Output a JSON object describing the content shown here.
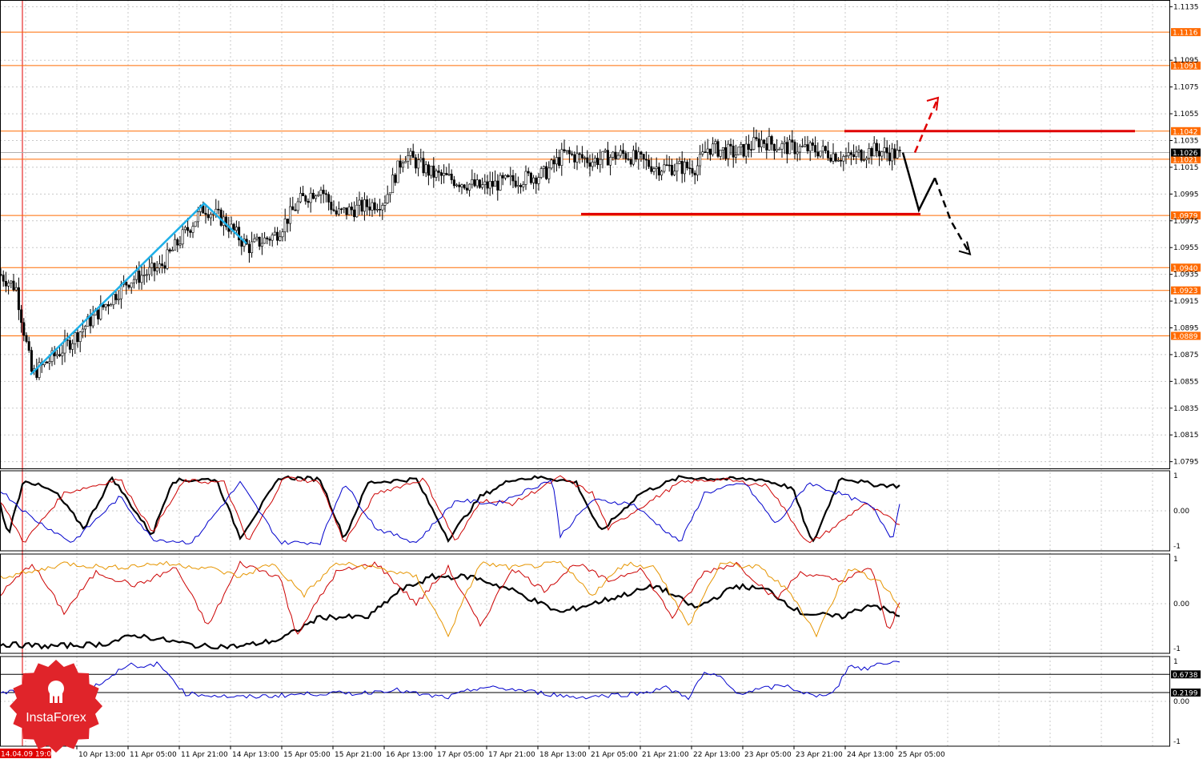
{
  "chart_data": [
    {
      "type": "candlestick",
      "title": "",
      "price_ticks": [
        "1.1135",
        "1.1095",
        "1.1075",
        "1.1055",
        "1.1035",
        "1.1015",
        "1.0995",
        "1.0975",
        "1.0955",
        "1.0935",
        "1.0915",
        "1.0895",
        "1.0875",
        "1.0855",
        "1.0835",
        "1.0815",
        "1.0795"
      ],
      "ylim": [
        1.079,
        1.114
      ],
      "x_tick_labels": [
        "14.04.09 19:00",
        "10 Apr 13:00",
        "11 Apr 05:00",
        "11 Apr 21:00",
        "14 Apr 13:00",
        "15 Apr 05:00",
        "15 Apr 21:00",
        "16 Apr 13:00",
        "17 Apr 05:00",
        "17 Apr 21:00",
        "18 Apr 13:00",
        "21 Apr 05:00",
        "21 Apr 21:00",
        "22 Apr 13:00",
        "23 Apr 05:00",
        "23 Apr 21:00",
        "24 Apr 13:00",
        "25 Apr 05:00"
      ],
      "levels": [
        {
          "label": "1.1116",
          "value": 1.1116
        },
        {
          "label": "1.1091",
          "value": 1.1091
        },
        {
          "label": "1.1042",
          "value": 1.1042
        },
        {
          "label": "1.1021",
          "value": 1.1021
        },
        {
          "label": "1.0979",
          "value": 1.0979
        },
        {
          "label": "1.0940",
          "value": 1.094
        },
        {
          "label": "1.0923",
          "value": 1.0923
        },
        {
          "label": "1.0889",
          "value": 1.0889
        }
      ],
      "current_price": {
        "label": "1.1026",
        "value": 1.1026
      },
      "close_anchors": [
        [
          0,
          1.0935
        ],
        [
          20,
          1.0925
        ],
        [
          40,
          1.086
        ],
        [
          80,
          1.088
        ],
        [
          120,
          1.0905
        ],
        [
          160,
          1.093
        ],
        [
          200,
          1.094
        ],
        [
          230,
          1.0965
        ],
        [
          255,
          1.0985
        ],
        [
          280,
          1.0975
        ],
        [
          310,
          1.0955
        ],
        [
          345,
          1.0965
        ],
        [
          375,
          1.099
        ],
        [
          400,
          1.1
        ],
        [
          420,
          1.098
        ],
        [
          450,
          1.0985
        ],
        [
          480,
          1.099
        ],
        [
          505,
          1.1025
        ],
        [
          540,
          1.101
        ],
        [
          570,
          1.1005
        ],
        [
          600,
          1.1
        ],
        [
          640,
          1.1005
        ],
        [
          680,
          1.101
        ],
        [
          705,
          1.1025
        ],
        [
          740,
          1.102
        ],
        [
          780,
          1.1025
        ],
        [
          820,
          1.1015
        ],
        [
          870,
          1.1015
        ],
        [
          885,
          1.103
        ],
        [
          920,
          1.1025
        ],
        [
          950,
          1.1035
        ],
        [
          980,
          1.103
        ],
        [
          1020,
          1.1028
        ],
        [
          1060,
          1.1022
        ],
        [
          1090,
          1.1028
        ],
        [
          1125,
          1.1024
        ]
      ],
      "support_line": 1.098,
      "resistance_line": 1.1042,
      "forecast_down": [
        [
          1128,
          1.1026
        ],
        [
          1148,
          1.0983
        ],
        [
          1168,
          1.1007
        ],
        [
          1188,
          1.0975
        ],
        [
          1212,
          1.095
        ]
      ],
      "forecast_up": [
        [
          1143,
          1.1026
        ],
        [
          1172,
          1.1067
        ]
      ]
    },
    {
      "type": "line",
      "panel": "oscillator-1",
      "y_ticks": [
        "1",
        "0.00",
        "-1"
      ],
      "ylim": [
        -1,
        1
      ],
      "series": [
        {
          "color": "#000000",
          "anchors": [
            [
              0,
              0.2
            ],
            [
              10,
              -0.7
            ],
            [
              30,
              0.9
            ],
            [
              70,
              0.5
            ],
            [
              105,
              -0.5
            ],
            [
              140,
              0.95
            ],
            [
              190,
              -0.7
            ],
            [
              215,
              0.85
            ],
            [
              270,
              0.9
            ],
            [
              300,
              -0.75
            ],
            [
              350,
              0.95
            ],
            [
              400,
              0.9
            ],
            [
              430,
              -0.8
            ],
            [
              460,
              0.8
            ],
            [
              520,
              0.9
            ],
            [
              560,
              -0.8
            ],
            [
              600,
              0.4
            ],
            [
              640,
              0.9
            ],
            [
              680,
              0.95
            ],
            [
              720,
              0.8
            ],
            [
              750,
              -0.6
            ],
            [
              800,
              0.5
            ],
            [
              850,
              0.95
            ],
            [
              910,
              0.9
            ],
            [
              950,
              0.9
            ],
            [
              990,
              0.65
            ],
            [
              1015,
              -0.95
            ],
            [
              1050,
              0.95
            ],
            [
              1090,
              0.75
            ],
            [
              1125,
              0.7
            ]
          ]
        },
        {
          "color": "#cc0000",
          "anchors": [
            [
              0,
              0.3
            ],
            [
              30,
              -0.9
            ],
            [
              80,
              0.5
            ],
            [
              150,
              0.9
            ],
            [
              190,
              -0.6
            ],
            [
              230,
              0.85
            ],
            [
              280,
              0.8
            ],
            [
              310,
              -0.9
            ],
            [
              355,
              0.95
            ],
            [
              400,
              0.8
            ],
            [
              430,
              -0.9
            ],
            [
              470,
              0.5
            ],
            [
              530,
              0.9
            ],
            [
              570,
              -0.9
            ],
            [
              600,
              0.3
            ],
            [
              640,
              0.2
            ],
            [
              700,
              0.95
            ],
            [
              740,
              0.5
            ],
            [
              760,
              -0.5
            ],
            [
              800,
              0.1
            ],
            [
              850,
              0.8
            ],
            [
              900,
              0.9
            ],
            [
              960,
              0.7
            ],
            [
              1010,
              -0.95
            ],
            [
              1040,
              -0.5
            ],
            [
              1080,
              0.2
            ],
            [
              1125,
              -0.4
            ]
          ]
        },
        {
          "color": "#0000cc",
          "anchors": [
            [
              0,
              0.6
            ],
            [
              40,
              -0.2
            ],
            [
              90,
              -0.9
            ],
            [
              150,
              0.4
            ],
            [
              190,
              -0.8
            ],
            [
              240,
              -0.9
            ],
            [
              300,
              0.8
            ],
            [
              350,
              -0.9
            ],
            [
              400,
              -0.9
            ],
            [
              430,
              0.8
            ],
            [
              470,
              -0.5
            ],
            [
              520,
              -0.9
            ],
            [
              570,
              0.3
            ],
            [
              620,
              0.2
            ],
            [
              690,
              0.9
            ],
            [
              700,
              -0.7
            ],
            [
              740,
              0.3
            ],
            [
              790,
              0.2
            ],
            [
              850,
              -0.9
            ],
            [
              880,
              0.5
            ],
            [
              930,
              0.8
            ],
            [
              970,
              -0.4
            ],
            [
              1010,
              0.8
            ],
            [
              1060,
              0.4
            ],
            [
              1090,
              0.1
            ],
            [
              1115,
              -0.8
            ],
            [
              1125,
              0.3
            ]
          ]
        }
      ]
    },
    {
      "type": "line",
      "panel": "oscillator-2",
      "y_ticks": [
        "1",
        "0.00",
        "-1"
      ],
      "ylim": [
        -1,
        1
      ],
      "series": [
        {
          "color": "#000000",
          "anchors": [
            [
              0,
              -0.9
            ],
            [
              60,
              -0.95
            ],
            [
              130,
              -0.9
            ],
            [
              170,
              -0.7
            ],
            [
              250,
              -0.95
            ],
            [
              300,
              -0.95
            ],
            [
              350,
              -0.8
            ],
            [
              400,
              -0.3
            ],
            [
              460,
              -0.3
            ],
            [
              500,
              0.3
            ],
            [
              540,
              0.6
            ],
            [
              590,
              0.6
            ],
            [
              640,
              0.3
            ],
            [
              700,
              -0.2
            ],
            [
              760,
              0.1
            ],
            [
              820,
              0.4
            ],
            [
              870,
              -0.1
            ],
            [
              920,
              0.4
            ],
            [
              960,
              0.3
            ],
            [
              1000,
              -0.2
            ],
            [
              1050,
              -0.3
            ],
            [
              1090,
              0
            ],
            [
              1125,
              -0.3
            ]
          ]
        },
        {
          "color": "#cc0000",
          "anchors": [
            [
              0,
              0.2
            ],
            [
              40,
              0.9
            ],
            [
              80,
              -0.2
            ],
            [
              120,
              0.7
            ],
            [
              170,
              0.4
            ],
            [
              220,
              0.8
            ],
            [
              260,
              -0.5
            ],
            [
              300,
              0.9
            ],
            [
              350,
              0.6
            ],
            [
              370,
              -0.7
            ],
            [
              420,
              0.7
            ],
            [
              470,
              0.9
            ],
            [
              520,
              0
            ],
            [
              560,
              0.8
            ],
            [
              600,
              -0.5
            ],
            [
              640,
              0.8
            ],
            [
              680,
              0.3
            ],
            [
              720,
              0.9
            ],
            [
              760,
              0.5
            ],
            [
              800,
              0.8
            ],
            [
              840,
              -0.3
            ],
            [
              880,
              0.7
            ],
            [
              920,
              0.9
            ],
            [
              970,
              0.1
            ],
            [
              1000,
              0.7
            ],
            [
              1050,
              0.5
            ],
            [
              1090,
              0.8
            ],
            [
              1110,
              -0.7
            ],
            [
              1125,
              0.1
            ]
          ]
        },
        {
          "color": "#e69500",
          "anchors": [
            [
              0,
              0.6
            ],
            [
              40,
              0.7
            ],
            [
              80,
              0.9
            ],
            [
              140,
              0.8
            ],
            [
              200,
              0.9
            ],
            [
              260,
              0.8
            ],
            [
              300,
              0.6
            ],
            [
              340,
              0.9
            ],
            [
              380,
              0.2
            ],
            [
              420,
              0.9
            ],
            [
              470,
              0.8
            ],
            [
              520,
              0.6
            ],
            [
              560,
              -0.7
            ],
            [
              600,
              0.9
            ],
            [
              640,
              0.8
            ],
            [
              700,
              0.9
            ],
            [
              740,
              0.2
            ],
            [
              780,
              0.9
            ],
            [
              820,
              0.8
            ],
            [
              860,
              -0.5
            ],
            [
              900,
              0.9
            ],
            [
              950,
              0.8
            ],
            [
              990,
              0.2
            ],
            [
              1020,
              -0.7
            ],
            [
              1060,
              0.8
            ],
            [
              1100,
              0.5
            ],
            [
              1125,
              -0.1
            ]
          ]
        }
      ]
    },
    {
      "type": "line",
      "panel": "oscillator-3",
      "y_ticks": [
        "1",
        "0.00",
        "-1"
      ],
      "ylim": [
        -1,
        1
      ],
      "levels": [
        {
          "label": "0.6738",
          "value": 0.6738
        },
        {
          "label": "0.2199",
          "value": 0.2199
        }
      ],
      "series": [
        {
          "color": "#0000cc",
          "anchors": [
            [
              0,
              0.2
            ],
            [
              60,
              0.3
            ],
            [
              110,
              0.3
            ],
            [
              130,
              0.5
            ],
            [
              160,
              0.95
            ],
            [
              175,
              0.8
            ],
            [
              195,
              0.95
            ],
            [
              215,
              0.6
            ],
            [
              230,
              0.2
            ],
            [
              300,
              0.1
            ],
            [
              350,
              0.15
            ],
            [
              400,
              0.2
            ],
            [
              450,
              0.2
            ],
            [
              490,
              0.3
            ],
            [
              530,
              0.15
            ],
            [
              560,
              0.1
            ],
            [
              600,
              0.35
            ],
            [
              640,
              0.3
            ],
            [
              680,
              0.2
            ],
            [
              720,
              0.1
            ],
            [
              760,
              0.15
            ],
            [
              800,
              0.2
            ],
            [
              830,
              0.35
            ],
            [
              860,
              0.1
            ],
            [
              880,
              0.7
            ],
            [
              900,
              0.6
            ],
            [
              920,
              0.2
            ],
            [
              980,
              0.4
            ],
            [
              1020,
              0.1
            ],
            [
              1045,
              0.3
            ],
            [
              1060,
              0.9
            ],
            [
              1080,
              0.8
            ],
            [
              1100,
              0.95
            ],
            [
              1125,
              1.0
            ]
          ]
        }
      ]
    }
  ],
  "brand": {
    "name": "InstaForex",
    "color": "#e0242a"
  },
  "colors": {
    "level_line": "#ff6a00",
    "support_resistance": "#e00000",
    "zigzag": "#1fb0e8",
    "grid": "#c8c8c8"
  }
}
